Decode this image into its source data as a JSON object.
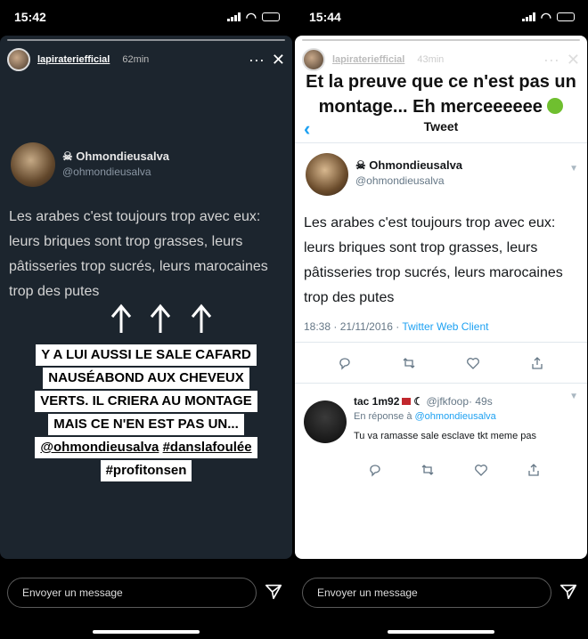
{
  "left": {
    "status_time": "15:42",
    "username": "lapirateriefficial",
    "time_ago": "62min",
    "tweet": {
      "name": "Ohmondieusalva",
      "handle": "@ohmondieusalva",
      "text": "Les arabes c'est toujours trop avec eux: leurs briques sont trop grasses, leurs pâtisseries trop sucrés, leurs marocaines trop des putes"
    },
    "caption": {
      "line1": "Y A LUI AUSSI LE SALE CAFARD",
      "line2": "NAUSÉABOND AUX CHEVEUX",
      "line3": "VERTS. IL CRIERA AU MONTAGE",
      "line4": "MAIS CE N'EN EST PAS UN...",
      "mention": "@ohmondieusalva",
      "hashtag1": "#danslafoulée",
      "hashtag2": "#profitonsen"
    },
    "reply_placeholder": "Envoyer un message"
  },
  "right": {
    "status_time": "15:44",
    "username": "lapirateriefficial",
    "time_ago": "43min",
    "title_line1": "Et la preuve que ce n'est pas un",
    "title_line2": "montage... Eh merceeeeee",
    "tweet_header": "Tweet",
    "tweet": {
      "name": "Ohmondieusalva",
      "handle": "@ohmondieusalva",
      "text": "Les arabes c'est toujours trop avec eux: leurs briques sont trop grasses, leurs pâtisseries trop sucrés, leurs marocaines trop des putes",
      "time": "18:38 · 21/11/2016 · ",
      "client": "Twitter Web Client"
    },
    "reply": {
      "name": "tac 1m92",
      "handle": "@jfkfoop",
      "age": "· 49s",
      "in_reply_prefix": "En réponse à ",
      "in_reply_to": "@ohmondieusalva",
      "text": "Tu va ramasse sale esclave tkt meme pas"
    },
    "reply_placeholder": "Envoyer un message"
  }
}
